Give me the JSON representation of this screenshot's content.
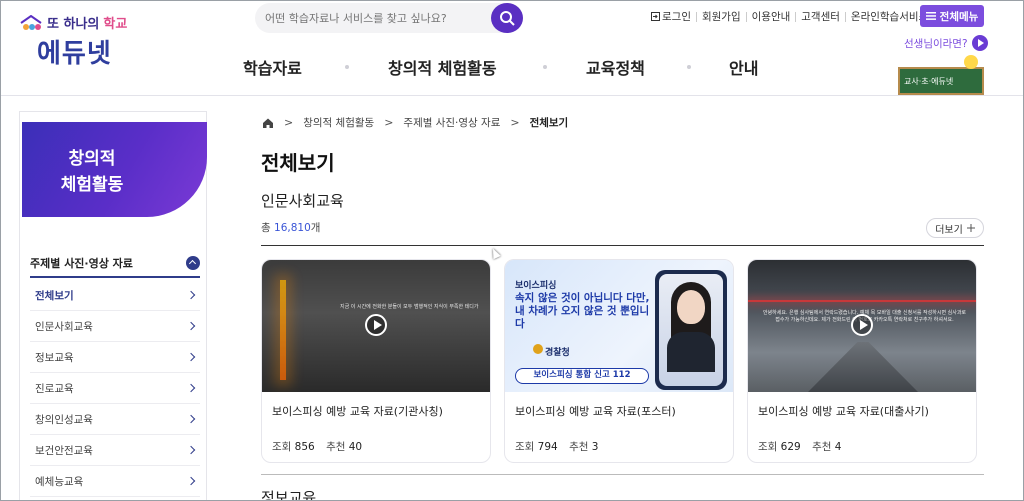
{
  "logo": {
    "tagline_prefix": "또 하나의",
    "tagline_accent": "학교",
    "name": "에듀넷"
  },
  "search": {
    "placeholder": "어떤 학습자료나 서비스를 찾고 싶나요?"
  },
  "util_links": [
    "로그인",
    "회원가입",
    "이용안내",
    "고객센터",
    "온라인학습서비스"
  ],
  "all_menu_label": "전체메뉴",
  "gnb": [
    "학습자료",
    "창의적 체험활동",
    "교육정책",
    "안내"
  ],
  "teacher_link": "선생님이라면?",
  "teacher_banner": "교사·초·에듀넷",
  "sidebar": {
    "banner_line1": "창의적",
    "banner_line2": "체험활동",
    "section_title": "주제별 사진·영상 자료",
    "items": [
      {
        "label": "전체보기",
        "active": true
      },
      {
        "label": "인문사회교육"
      },
      {
        "label": "정보교육"
      },
      {
        "label": "진로교육"
      },
      {
        "label": "창의인성교육"
      },
      {
        "label": "보건안전교육"
      },
      {
        "label": "예체능교육"
      }
    ]
  },
  "breadcrumb": [
    "창의적 체험활동",
    "주제별 사진·영상 자료",
    "전체보기"
  ],
  "page_title": "전체보기",
  "section": {
    "title": "인문사회교육",
    "total_prefix": "총",
    "total_count": "16,810",
    "total_suffix": "개",
    "more_label": "더보기"
  },
  "next_section_title": "정보교육",
  "cards": [
    {
      "title": "보이스피싱 예방 교육 자료(기관사칭)",
      "views_label": "조회",
      "views": "856",
      "likes_label": "추천",
      "likes": "40",
      "thumb_caption": "지금 이 시간에 전화한 분들이 모두 범행적인 지식이 부족한 테디가"
    },
    {
      "title": "보이스피싱 예방 교육 자료(포스터)",
      "views_label": "조회",
      "views": "794",
      "likes_label": "추천",
      "likes": "3",
      "poster_label": "보이스피싱",
      "poster_headline": "속지 않은 것이 아닙니다 다만, 내 차례가 오지 않은 것 뿐입니다",
      "poster_agency": "경찰청",
      "poster_hotline": "보이스피싱 통합 신고 112"
    },
    {
      "title": "보이스피싱 예방 교육 자료(대출사기)",
      "views_label": "조회",
      "views": "629",
      "likes_label": "추천",
      "likes": "4",
      "thumb_caption": "안녕하세요. 은행 심사팀에서 연락드렸습니다. 예체 목 모바일 대출 신청서를 작성하시면 심사과로 접수가 가능하신데요. 제가 전화드린 이 번호로 카카오톡 연락처로 친구추가 하셔서요."
    }
  ],
  "colors": {
    "brand_purple": "#5a2fc2",
    "accent_blue": "#2f3c8a",
    "count_blue": "#3a55d6"
  }
}
